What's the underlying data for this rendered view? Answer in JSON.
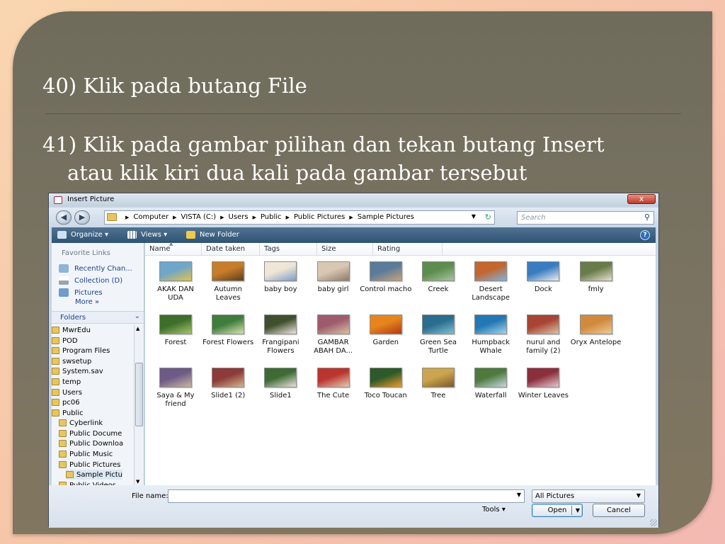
{
  "slide": {
    "line1": "40) Klik pada butang File",
    "line2a": "41) Klik pada gambar pilihan dan tekan butang Insert",
    "line2b": "atau klik kiri dua kali pada gambar tersebut"
  },
  "dialog": {
    "title": "Insert Picture",
    "close": "x",
    "address": {
      "crumbs": [
        "Computer",
        "VISTA (C:)",
        "Users",
        "Public",
        "Public Pictures",
        "Sample Pictures"
      ]
    },
    "search_placeholder": "Search",
    "toolbar": {
      "organize": "Organize ▾",
      "views": "Views ▾",
      "new_folder": "New Folder",
      "help": "?"
    },
    "favorites": {
      "header": "Favorite Links",
      "items": [
        "Recently Chan...",
        "Collection (D)",
        "Pictures"
      ],
      "more": "More »"
    },
    "folders": {
      "header": "Folders",
      "items": [
        "MwrEdu",
        "POD",
        "Program Files",
        "swsetup",
        "System.sav",
        "temp",
        "Users",
        "pc06",
        "Public",
        "Cyberlink",
        "Public Docume",
        "Public Downloa",
        "Public Music",
        "Public Pictures",
        "Sample Pictu",
        "Public Videos"
      ],
      "selected": "Sample Pictu"
    },
    "columns": [
      "Name",
      "Date taken",
      "Tags",
      "Size",
      "Rating"
    ],
    "files": [
      {
        "name": "AKAK DAN UDA",
        "c1": "#6fa6c9",
        "c2": "#e1c24d"
      },
      {
        "name": "Autumn Leaves",
        "c1": "#c77d2a",
        "c2": "#5c3d1e"
      },
      {
        "name": "baby boy",
        "c1": "#f0e6d8",
        "c2": "#7b9ec4"
      },
      {
        "name": "baby girl",
        "c1": "#d9c7b4",
        "c2": "#8f7a6a"
      },
      {
        "name": "Control macho",
        "c1": "#5a7b9a",
        "c2": "#c9a27a"
      },
      {
        "name": "Creek",
        "c1": "#5d8d4e",
        "c2": "#a9c4a0"
      },
      {
        "name": "Desert Landscape",
        "c1": "#c4662f",
        "c2": "#7fb3dd"
      },
      {
        "name": "Dock",
        "c1": "#3a7cc0",
        "c2": "#e8eef4"
      },
      {
        "name": "fmly",
        "c1": "#6a7b4a",
        "c2": "#e8e0d0"
      },
      {
        "name": "Forest",
        "c1": "#3d6e2a",
        "c2": "#a6c46b"
      },
      {
        "name": "Forest Flowers",
        "c1": "#3f7d3c",
        "c2": "#d7e3b1"
      },
      {
        "name": "Frangipani Flowers",
        "c1": "#40502f",
        "c2": "#efe6e0"
      },
      {
        "name": "GAMBAR ABAH DA...",
        "c1": "#9e5b6c",
        "c2": "#d6c2a4"
      },
      {
        "name": "Garden",
        "c1": "#e6851e",
        "c2": "#b43a14"
      },
      {
        "name": "Green Sea Turtle",
        "c1": "#2a6d8f",
        "c2": "#7fc0cf"
      },
      {
        "name": "Humpback Whale",
        "c1": "#2378b4",
        "c2": "#a4d3ec"
      },
      {
        "name": "nurul and family (2)",
        "c1": "#a84434",
        "c2": "#d9c4a6"
      },
      {
        "name": "Oryx Antelope",
        "c1": "#d08a3e",
        "c2": "#f0c994"
      },
      {
        "name": "Saya & My friend",
        "c1": "#6d5a86",
        "c2": "#c9b6a0"
      },
      {
        "name": "Slide1 (2)",
        "c1": "#8c3a3a",
        "c2": "#d1b58a"
      },
      {
        "name": "Slide1",
        "c1": "#3e6b35",
        "c2": "#e8e4da"
      },
      {
        "name": "The Cute",
        "c1": "#b9362f",
        "c2": "#e6c9b0"
      },
      {
        "name": "Toco Toucan",
        "c1": "#2d5a2a",
        "c2": "#f09a2a"
      },
      {
        "name": "Tree",
        "c1": "#caa44e",
        "c2": "#7a5a2a"
      },
      {
        "name": "Waterfall",
        "c1": "#4e7a3e",
        "c2": "#c6d8e0"
      },
      {
        "name": "Winter Leaves",
        "c1": "#8c2f3d",
        "c2": "#e6c7cf"
      }
    ],
    "footer": {
      "file_name_label": "File name:",
      "file_name_value": "",
      "filter": "All Pictures",
      "tools": "Tools ▾",
      "open": "Open",
      "cancel": "Cancel"
    }
  }
}
